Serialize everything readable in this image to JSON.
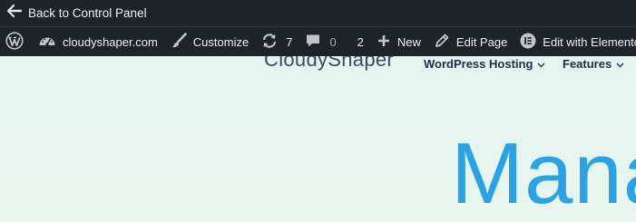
{
  "control_panel": {
    "back_label": "Back to Control Panel"
  },
  "admin_bar": {
    "site_name": "cloudyshaper.com",
    "customize_label": "Customize",
    "updates_count": "7",
    "comments_count": "0",
    "extra_count": "2",
    "new_label": "New",
    "edit_page_label": "Edit Page",
    "elementor_label": "Edit with Elementor",
    "colors": {
      "bar_bg": "#1d2327",
      "text": "#f0f0f1",
      "muted": "#a7aaad"
    }
  },
  "site": {
    "logo_text": "CloudyShaper",
    "nav": [
      {
        "label": "WordPress Hosting"
      },
      {
        "label": "Features"
      }
    ],
    "hero_text": "Mana",
    "colors": {
      "background": "#e6f5ef",
      "hero": "#2aa3e6",
      "nav": "#1f2b45"
    }
  }
}
